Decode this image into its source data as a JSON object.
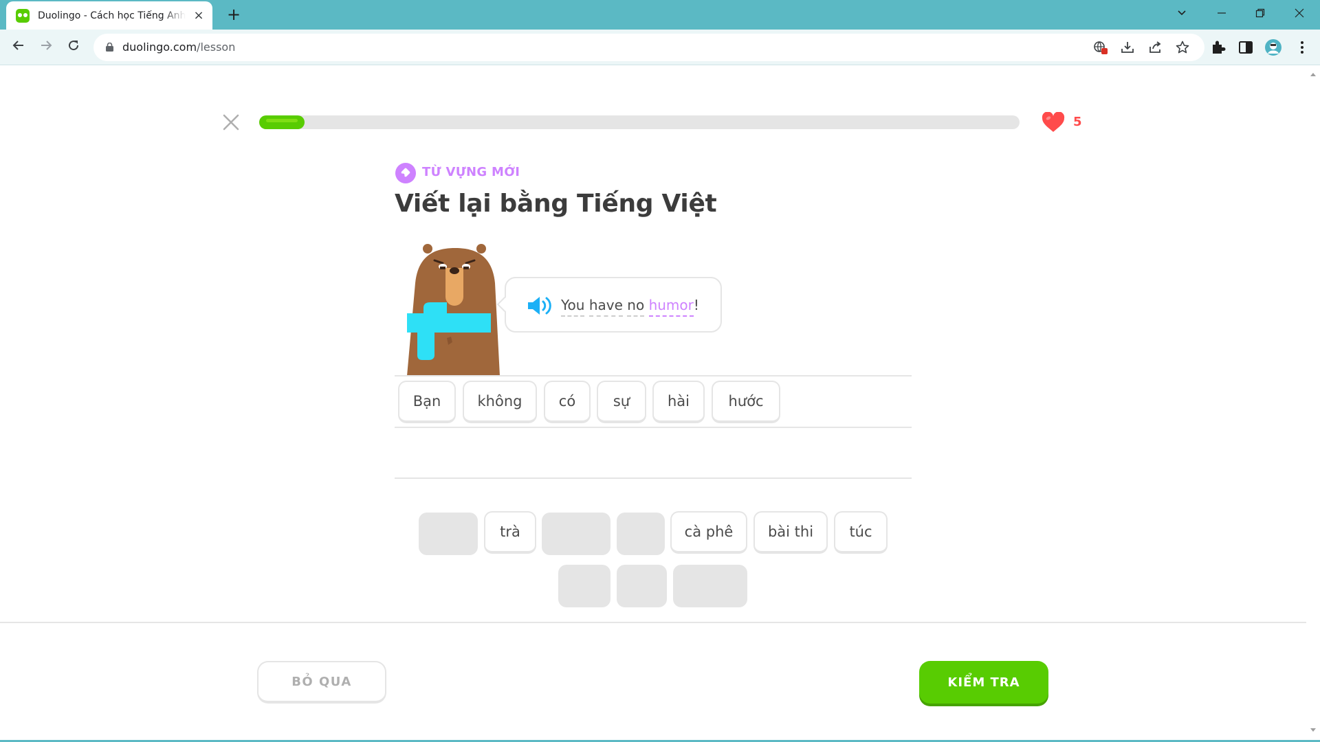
{
  "browser": {
    "tab_title": "Duolingo - Cách học Tiếng Anh",
    "tab_close": "×",
    "new_tab": "+",
    "url_host": "duolingo.com",
    "url_path": "/lesson",
    "icons": [
      "back-arrow-icon",
      "forward-arrow-icon",
      "reload-icon",
      "lock-icon",
      "translate-icon",
      "install-icon",
      "share-icon",
      "star-icon",
      "extensions-icon",
      "side-panel-icon",
      "profile-avatar",
      "more-menu-icon"
    ]
  },
  "lesson": {
    "progress": 0.06,
    "hearts": "5",
    "badge": "TỪ VỰNG MỚI",
    "heading": "Viết lại bằng Tiếng Việt",
    "sentence": {
      "w1": "You",
      "w2": "have",
      "w3": "no",
      "highlight": "humor",
      "punct": "!"
    },
    "answer_words": [
      "Bạn",
      "không",
      "có",
      "sự",
      "hài",
      "hước"
    ],
    "bank_row1": [
      "",
      "trà",
      "",
      "",
      "cà phê",
      "bài thi",
      "túc"
    ],
    "bank_row2": [
      "",
      "",
      ""
    ]
  },
  "footer": {
    "skip_label": "BỎ QUA",
    "check_label": "KIỂM TRA"
  },
  "colors": {
    "brand_green": "#58cc02",
    "accent_purple": "#ce82ff",
    "heart_red": "#ff4b4b",
    "chrome_teal": "#5bb9c4",
    "bear_brown": "#a0673b",
    "scarf_cyan": "#2ee0f6"
  }
}
